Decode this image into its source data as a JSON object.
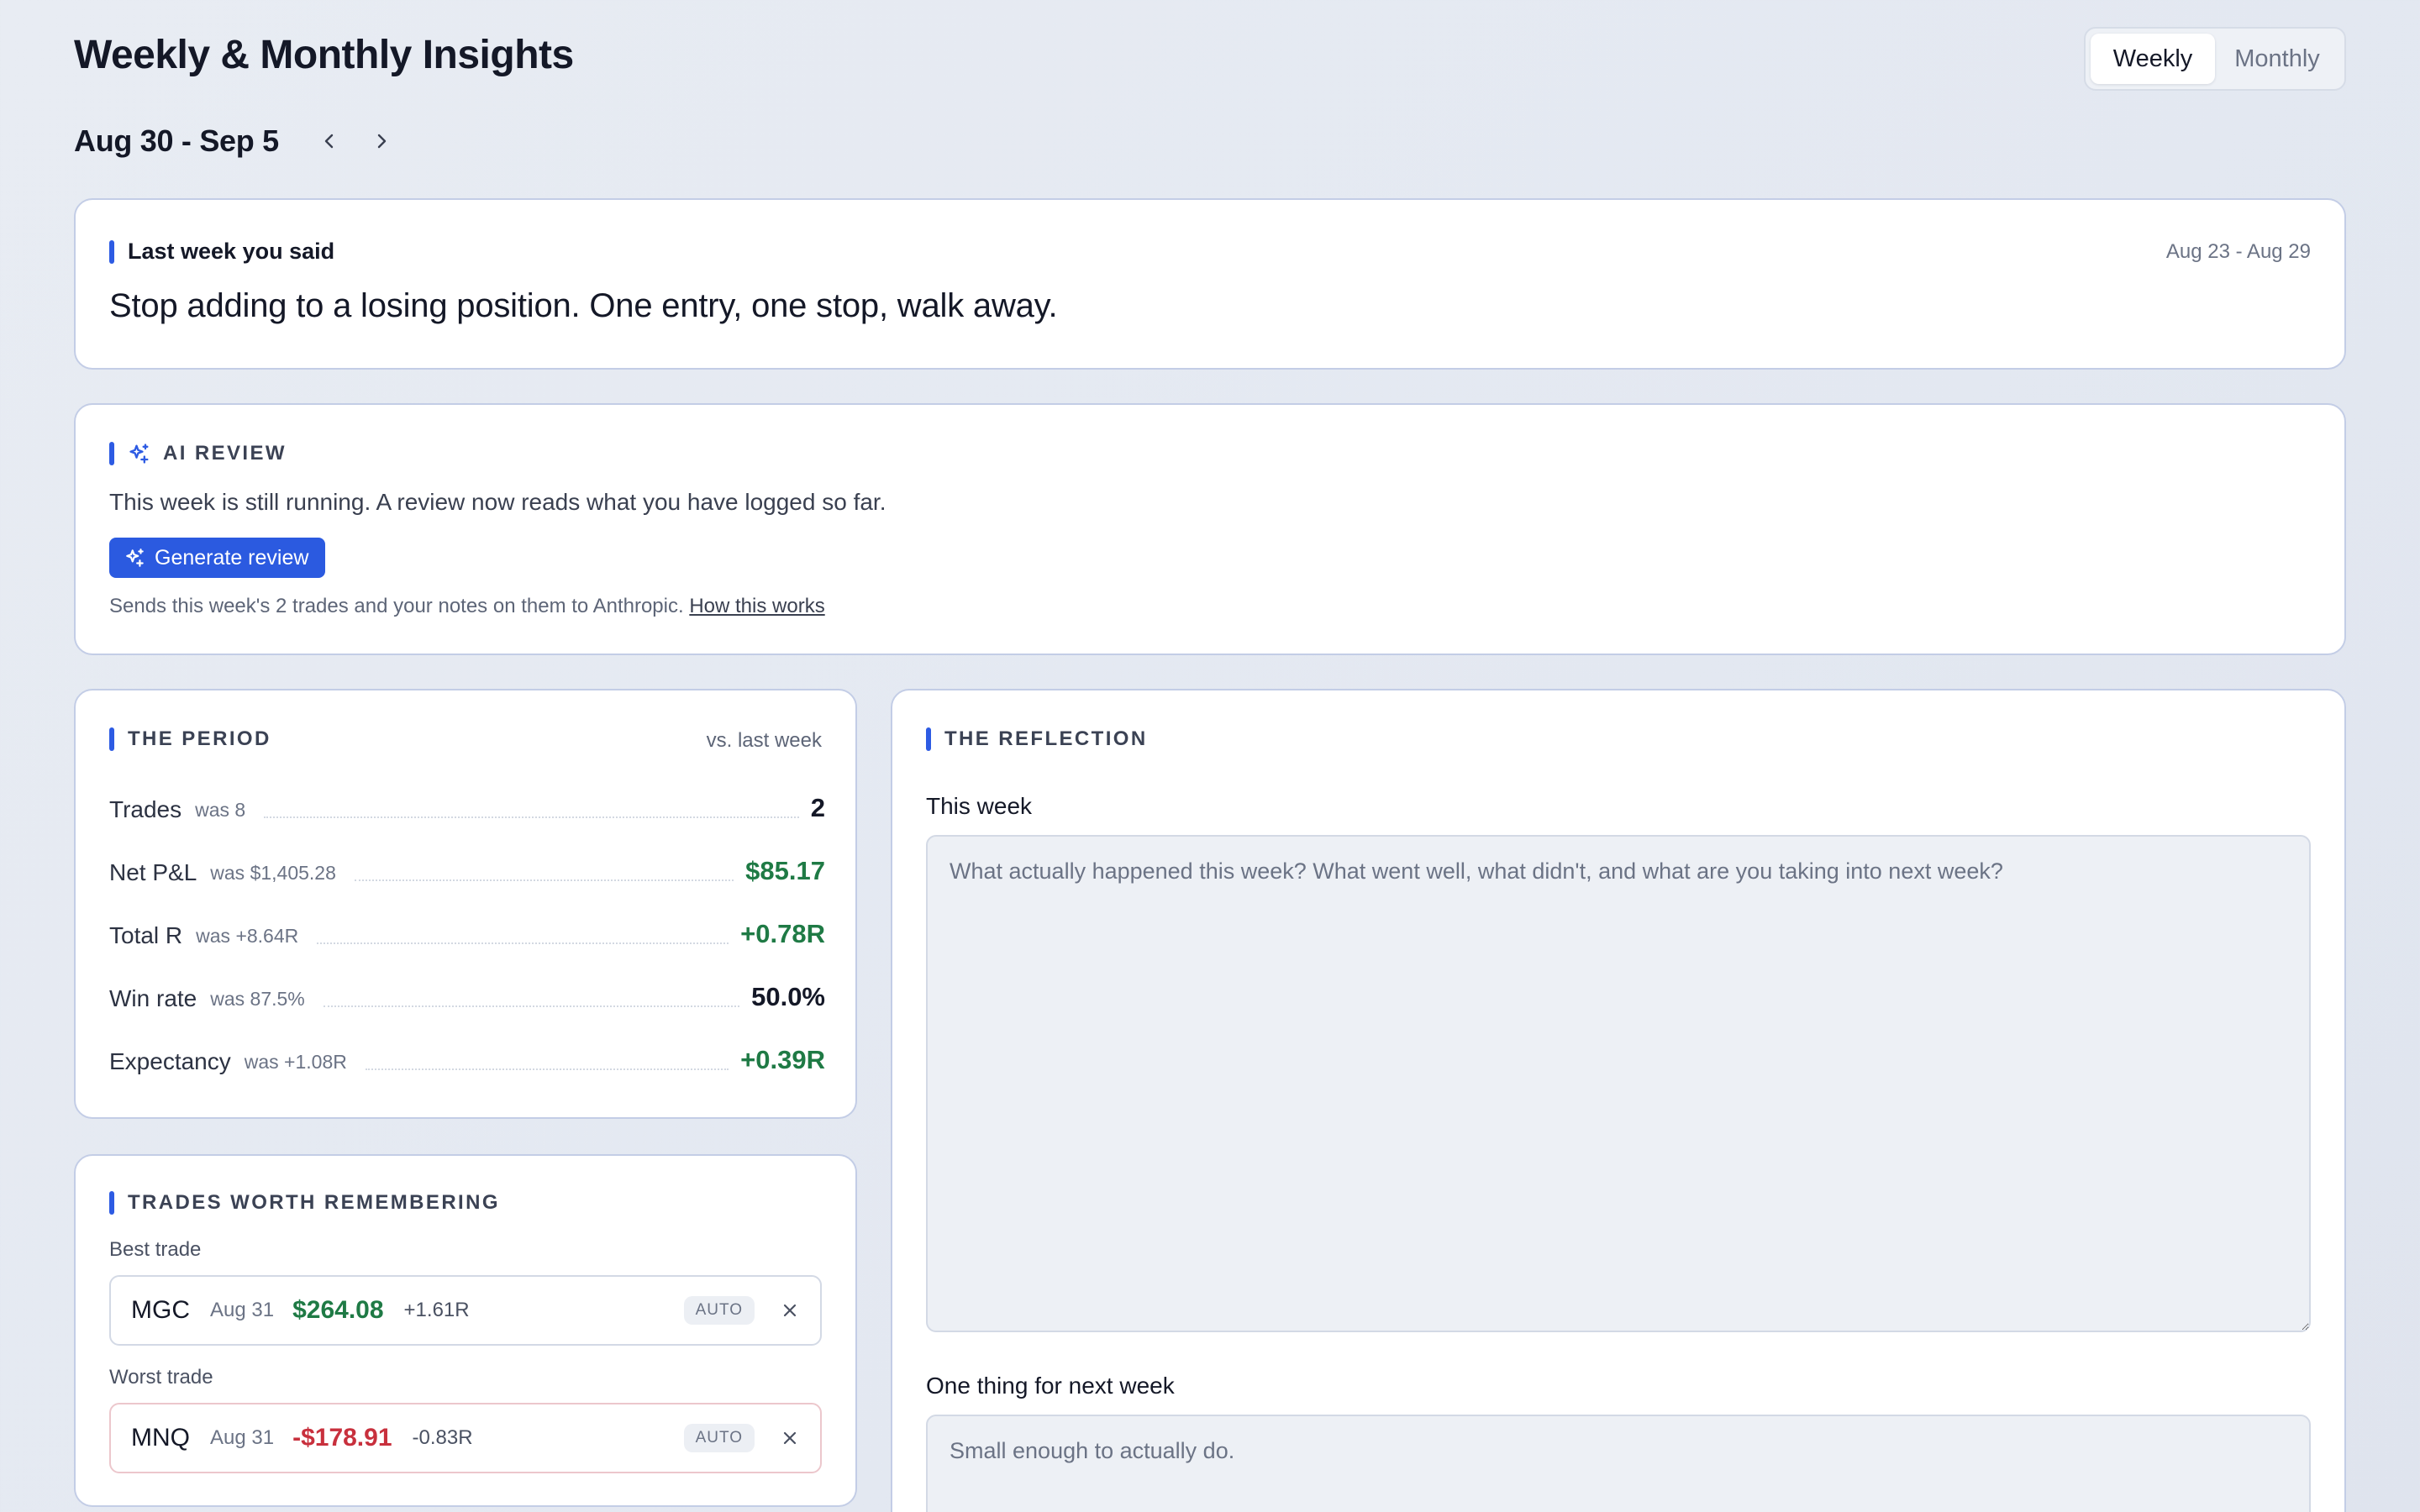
{
  "header": {
    "title": "Weekly & Monthly Insights",
    "toggle": {
      "weekly": "Weekly",
      "monthly": "Monthly",
      "selected": "Weekly"
    }
  },
  "period_nav": {
    "range": "Aug 30 - Sep 5",
    "prev_icon": "chevron-left-icon",
    "next_icon": "chevron-right-icon"
  },
  "last_week": {
    "heading": "Last week you said",
    "range": "Aug 23 - Aug 29",
    "quote": "Stop adding to a losing position. One entry, one stop, walk away."
  },
  "ai_review": {
    "heading": "AI REVIEW",
    "icon": "sparkles-icon",
    "text": "This week is still running. A review now reads what you have logged so far.",
    "button": "Generate review",
    "footnote": "Sends this week's 2 trades and your notes on them to Anthropic.",
    "link": "How this works"
  },
  "the_period": {
    "heading": "THE PERIOD",
    "comparison": "vs. last week",
    "stats": [
      {
        "name": "Trades",
        "was": "was 8",
        "value": "2",
        "tone": "neutral"
      },
      {
        "name": "Net P&L",
        "was": "was $1,405.28",
        "value": "$85.17",
        "tone": "pos"
      },
      {
        "name": "Total R",
        "was": "was +8.64R",
        "value": "+0.78R",
        "tone": "pos"
      },
      {
        "name": "Win rate",
        "was": "was 87.5%",
        "value": "50.0%",
        "tone": "neutral"
      },
      {
        "name": "Expectancy",
        "was": "was +1.08R",
        "value": "+0.39R",
        "tone": "pos"
      }
    ]
  },
  "trades_worth_remembering": {
    "heading": "TRADES WORTH REMEMBERING",
    "best": {
      "label": "Best trade",
      "symbol": "MGC",
      "date": "Aug 31",
      "pnl": "$264.08",
      "r": "+1.61R",
      "badge": "AUTO"
    },
    "worst": {
      "label": "Worst trade",
      "symbol": "MNQ",
      "date": "Aug 31",
      "pnl": "-$178.91",
      "r": "-0.83R",
      "badge": "AUTO"
    }
  },
  "reflection": {
    "heading": "THE REFLECTION",
    "this_week": {
      "label": "This week",
      "value": "",
      "placeholder": "What actually happened this week? What went well, what didn't, and what are you taking into next week?"
    },
    "next_week": {
      "label": "One thing for next week",
      "value": "",
      "placeholder": "Small enough to actually do."
    }
  },
  "colors": {
    "accent": "#2d5be3",
    "positive": "#1f7a45",
    "negative": "#c8303d"
  }
}
